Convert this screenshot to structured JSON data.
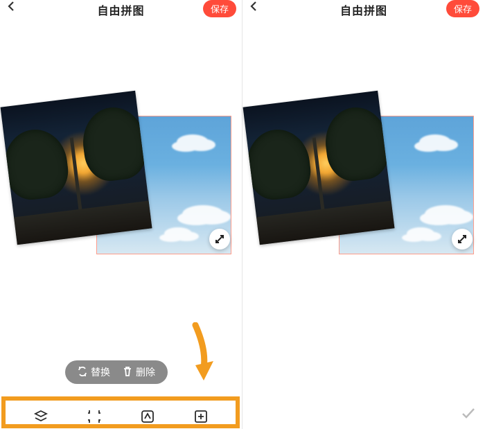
{
  "header": {
    "title": "自由拼图",
    "save_label": "保存"
  },
  "actions": {
    "replace": "替换",
    "delete": "删除"
  },
  "highlight_color": "#f29c1f",
  "accent_color": "#ff4b3a"
}
